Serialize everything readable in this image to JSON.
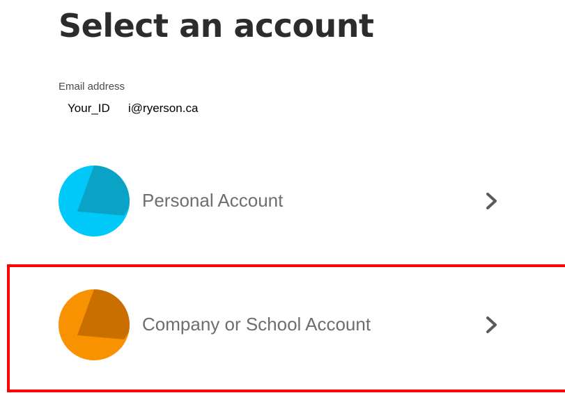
{
  "page": {
    "title": "Select an account"
  },
  "email": {
    "label": "Email address",
    "id_part": "Your_ID",
    "domain_part": "i@ryerson.ca"
  },
  "accounts": [
    {
      "label": "Personal Account",
      "avatar_color": "#00c8f8",
      "avatar_shade": "#0aa3c6"
    },
    {
      "label": "Company or School Account",
      "avatar_color": "#f89200",
      "avatar_shade": "#c96f00"
    }
  ],
  "icons": {
    "account_avatar": "avatar-icon",
    "navigate": "chevron-right-icon"
  },
  "highlight": {
    "color": "#ff0000"
  }
}
